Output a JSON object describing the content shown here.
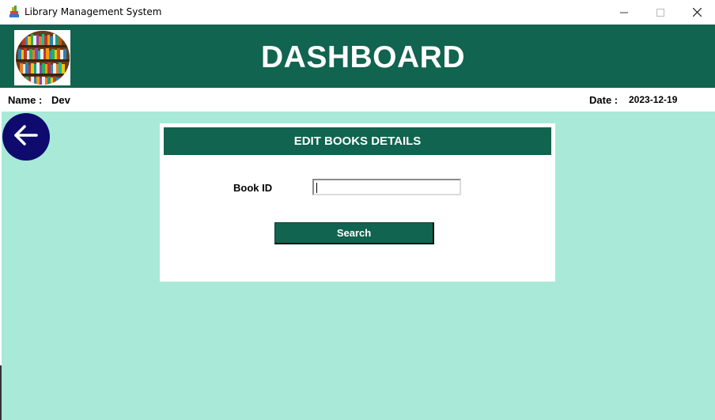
{
  "window": {
    "title": "Library Management System",
    "app_icon": "books-stack-icon",
    "controls": [
      "minimize-icon",
      "maximize-icon",
      "close-icon"
    ]
  },
  "header": {
    "logo": "bookshelf-logo",
    "title": "DASHBOARD"
  },
  "info": {
    "name_label": "Name :",
    "name_value": "Dev",
    "date_label": "Date :",
    "date_value": "2023-12-19"
  },
  "back_button": {
    "icon": "arrow-left-icon"
  },
  "panel": {
    "title": "EDIT BOOKS DETAILS",
    "book_id_label": "Book ID",
    "book_id_value": "",
    "search_label": "Search"
  },
  "colors": {
    "primary_green": "#11644f",
    "background_mint": "#a8ead7",
    "back_button_navy": "#0e0a6e",
    "white": "#ffffff"
  }
}
